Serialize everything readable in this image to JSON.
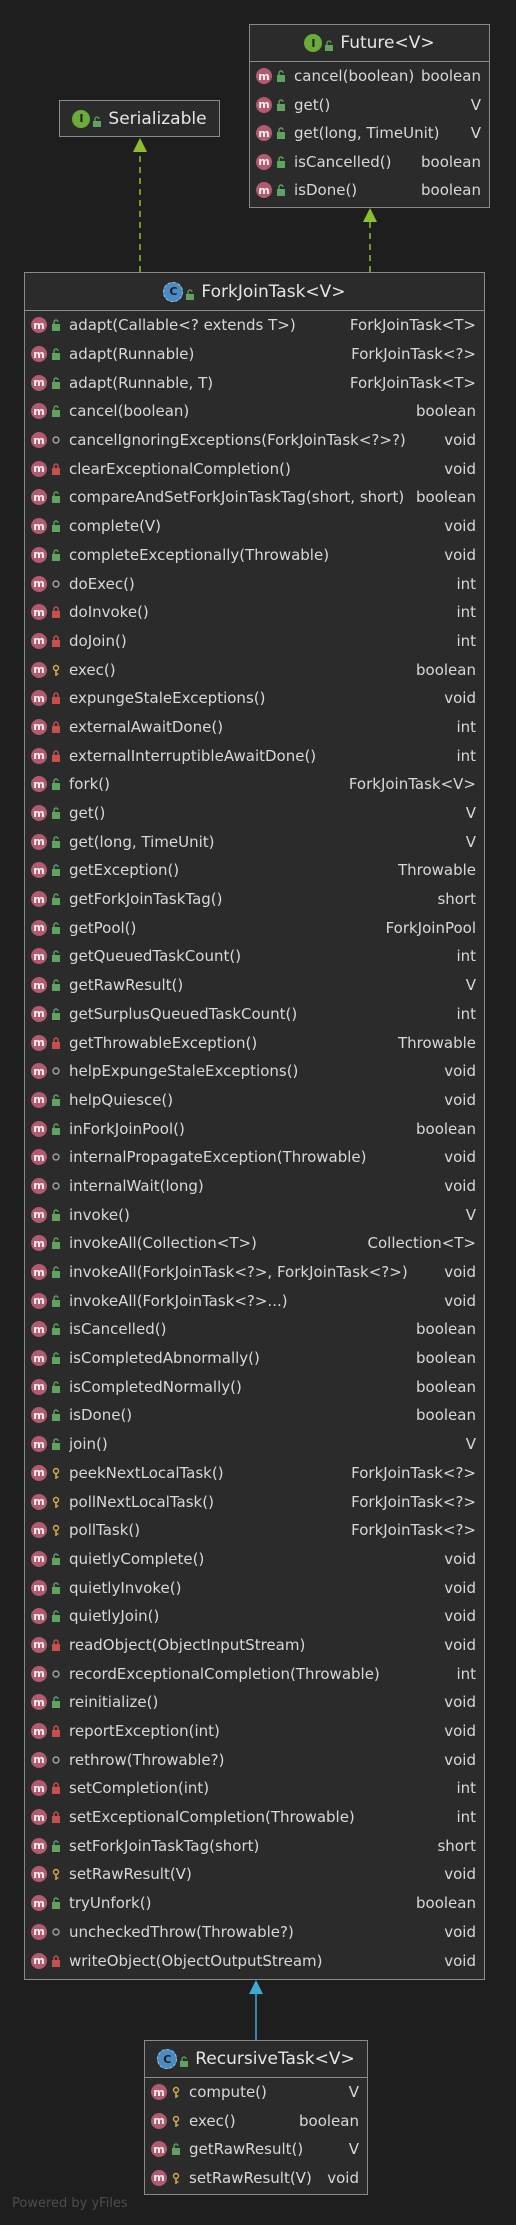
{
  "colors": {
    "background": "#1e1e1e",
    "box_fill": "#2b2b2b",
    "box_border": "#8a8a8a",
    "method_icon": "#b25a70",
    "public_vis": "#5fa35f",
    "private_vis": "#c94f4f",
    "package_vis": "#a0a0a0",
    "protected_vis": "#d4a94a",
    "implements_edge": "#8fbf2b",
    "extends_edge": "#3ea8d6"
  },
  "serializable": {
    "kind_icon": "interface-icon",
    "title": "Serializable"
  },
  "future": {
    "kind_icon": "interface-icon",
    "title": "Future<V>",
    "members": [
      {
        "name": "cancel(boolean)",
        "type": "boolean",
        "vis": "public"
      },
      {
        "name": "get()",
        "type": "V",
        "vis": "public"
      },
      {
        "name": "get(long, TimeUnit)",
        "type": "V",
        "vis": "public"
      },
      {
        "name": "isCancelled()",
        "type": "boolean",
        "vis": "public"
      },
      {
        "name": "isDone()",
        "type": "boolean",
        "vis": "public"
      }
    ]
  },
  "forkjointask": {
    "kind_icon": "abstract-class-icon",
    "title": "ForkJoinTask<V>",
    "members": [
      {
        "name": "adapt(Callable<? extends T>)",
        "type": "ForkJoinTask<T>",
        "vis": "public"
      },
      {
        "name": "adapt(Runnable)",
        "type": "ForkJoinTask<?>",
        "vis": "public"
      },
      {
        "name": "adapt(Runnable, T)",
        "type": "ForkJoinTask<T>",
        "vis": "public"
      },
      {
        "name": "cancel(boolean)",
        "type": "boolean",
        "vis": "public"
      },
      {
        "name": "cancelIgnoringExceptions(ForkJoinTask<?>?)",
        "type": "void",
        "vis": "package"
      },
      {
        "name": "clearExceptionalCompletion()",
        "type": "void",
        "vis": "private"
      },
      {
        "name": "compareAndSetForkJoinTaskTag(short, short)",
        "type": "boolean",
        "vis": "public"
      },
      {
        "name": "complete(V)",
        "type": "void",
        "vis": "public"
      },
      {
        "name": "completeExceptionally(Throwable)",
        "type": "void",
        "vis": "public"
      },
      {
        "name": "doExec()",
        "type": "int",
        "vis": "package"
      },
      {
        "name": "doInvoke()",
        "type": "int",
        "vis": "private"
      },
      {
        "name": "doJoin()",
        "type": "int",
        "vis": "private"
      },
      {
        "name": "exec()",
        "type": "boolean",
        "vis": "protected"
      },
      {
        "name": "expungeStaleExceptions()",
        "type": "void",
        "vis": "private"
      },
      {
        "name": "externalAwaitDone()",
        "type": "int",
        "vis": "private"
      },
      {
        "name": "externalInterruptibleAwaitDone()",
        "type": "int",
        "vis": "private"
      },
      {
        "name": "fork()",
        "type": "ForkJoinTask<V>",
        "vis": "public"
      },
      {
        "name": "get()",
        "type": "V",
        "vis": "public"
      },
      {
        "name": "get(long, TimeUnit)",
        "type": "V",
        "vis": "public"
      },
      {
        "name": "getException()",
        "type": "Throwable",
        "vis": "public"
      },
      {
        "name": "getForkJoinTaskTag()",
        "type": "short",
        "vis": "public"
      },
      {
        "name": "getPool()",
        "type": "ForkJoinPool",
        "vis": "public"
      },
      {
        "name": "getQueuedTaskCount()",
        "type": "int",
        "vis": "public"
      },
      {
        "name": "getRawResult()",
        "type": "V",
        "vis": "public"
      },
      {
        "name": "getSurplusQueuedTaskCount()",
        "type": "int",
        "vis": "public"
      },
      {
        "name": "getThrowableException()",
        "type": "Throwable",
        "vis": "private"
      },
      {
        "name": "helpExpungeStaleExceptions()",
        "type": "void",
        "vis": "package"
      },
      {
        "name": "helpQuiesce()",
        "type": "void",
        "vis": "public"
      },
      {
        "name": "inForkJoinPool()",
        "type": "boolean",
        "vis": "public"
      },
      {
        "name": "internalPropagateException(Throwable)",
        "type": "void",
        "vis": "package"
      },
      {
        "name": "internalWait(long)",
        "type": "void",
        "vis": "package"
      },
      {
        "name": "invoke()",
        "type": "V",
        "vis": "public"
      },
      {
        "name": "invokeAll(Collection<T>)",
        "type": "Collection<T>",
        "vis": "public"
      },
      {
        "name": "invokeAll(ForkJoinTask<?>, ForkJoinTask<?>)",
        "type": "void",
        "vis": "public"
      },
      {
        "name": "invokeAll(ForkJoinTask<?>...)",
        "type": "void",
        "vis": "public"
      },
      {
        "name": "isCancelled()",
        "type": "boolean",
        "vis": "public"
      },
      {
        "name": "isCompletedAbnormally()",
        "type": "boolean",
        "vis": "public"
      },
      {
        "name": "isCompletedNormally()",
        "type": "boolean",
        "vis": "public"
      },
      {
        "name": "isDone()",
        "type": "boolean",
        "vis": "public"
      },
      {
        "name": "join()",
        "type": "V",
        "vis": "public"
      },
      {
        "name": "peekNextLocalTask()",
        "type": "ForkJoinTask<?>",
        "vis": "protected"
      },
      {
        "name": "pollNextLocalTask()",
        "type": "ForkJoinTask<?>",
        "vis": "protected"
      },
      {
        "name": "pollTask()",
        "type": "ForkJoinTask<?>",
        "vis": "protected"
      },
      {
        "name": "quietlyComplete()",
        "type": "void",
        "vis": "public"
      },
      {
        "name": "quietlyInvoke()",
        "type": "void",
        "vis": "public"
      },
      {
        "name": "quietlyJoin()",
        "type": "void",
        "vis": "public"
      },
      {
        "name": "readObject(ObjectInputStream)",
        "type": "void",
        "vis": "private"
      },
      {
        "name": "recordExceptionalCompletion(Throwable)",
        "type": "int",
        "vis": "package"
      },
      {
        "name": "reinitialize()",
        "type": "void",
        "vis": "public"
      },
      {
        "name": "reportException(int)",
        "type": "void",
        "vis": "private"
      },
      {
        "name": "rethrow(Throwable?)",
        "type": "void",
        "vis": "package"
      },
      {
        "name": "setCompletion(int)",
        "type": "int",
        "vis": "private"
      },
      {
        "name": "setExceptionalCompletion(Throwable)",
        "type": "int",
        "vis": "private"
      },
      {
        "name": "setForkJoinTaskTag(short)",
        "type": "short",
        "vis": "public"
      },
      {
        "name": "setRawResult(V)",
        "type": "void",
        "vis": "protected"
      },
      {
        "name": "tryUnfork()",
        "type": "boolean",
        "vis": "public"
      },
      {
        "name": "uncheckedThrow(Throwable?)",
        "type": "void",
        "vis": "package"
      },
      {
        "name": "writeObject(ObjectOutputStream)",
        "type": "void",
        "vis": "private"
      }
    ]
  },
  "recursivetask": {
    "kind_icon": "abstract-class-icon",
    "title": "RecursiveTask<V>",
    "members": [
      {
        "name": "compute()",
        "type": "V",
        "vis": "protected"
      },
      {
        "name": "exec()",
        "type": "boolean",
        "vis": "protected"
      },
      {
        "name": "getRawResult()",
        "type": "V",
        "vis": "public"
      },
      {
        "name": "setRawResult(V)",
        "type": "void",
        "vis": "protected"
      }
    ]
  },
  "watermark": "Powered by yFiles"
}
